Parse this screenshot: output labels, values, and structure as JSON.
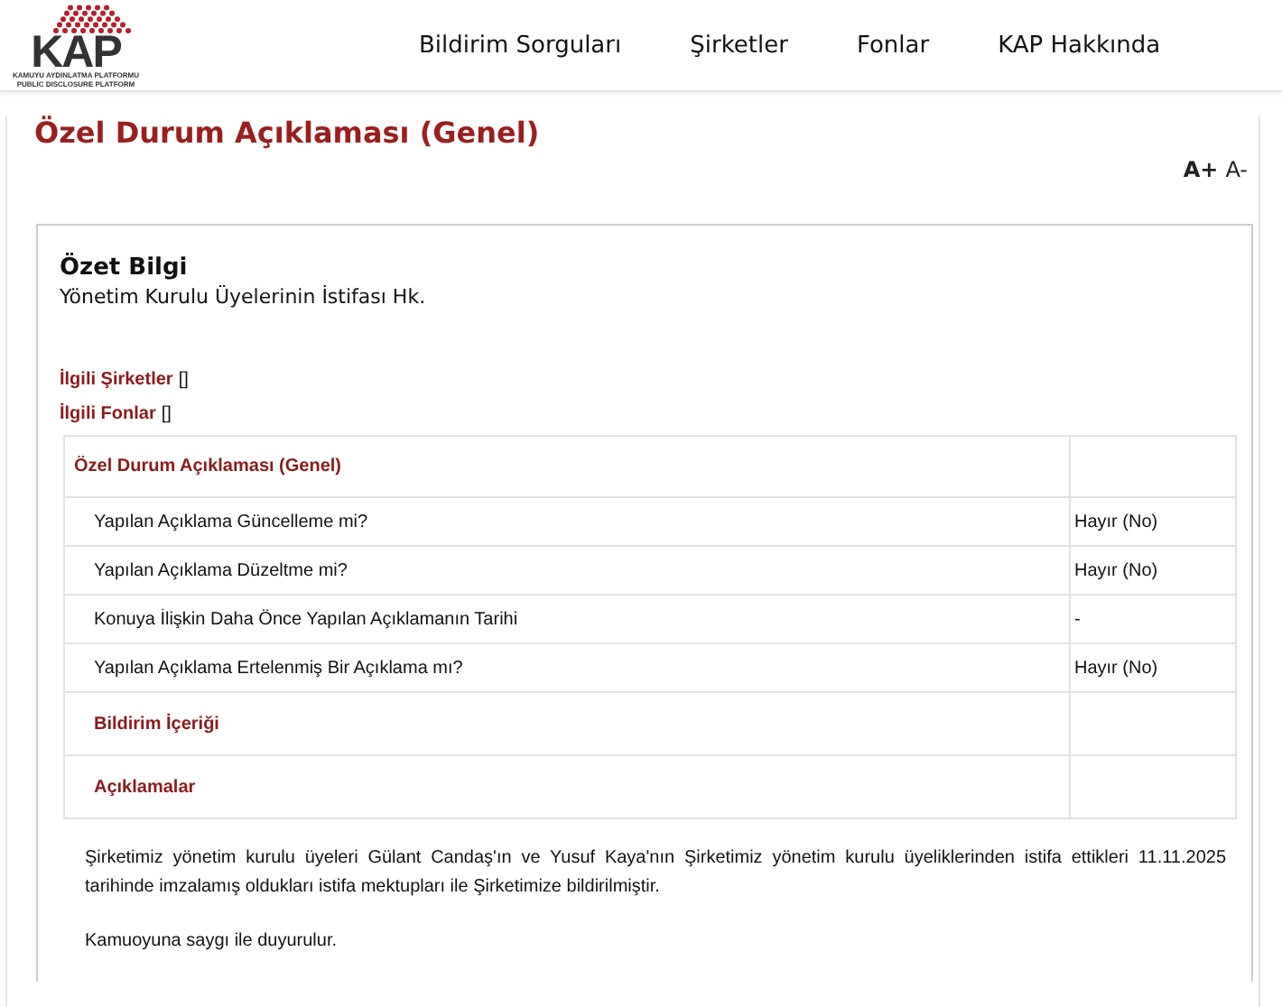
{
  "logo": {
    "mark": "KAP",
    "line_1": "KAMUYU AYDINLATMA PLATFORMU",
    "line_2": "PUBLIC DISCLOSURE PLATFORM"
  },
  "nav": [
    "Bildirim Sorguları",
    "Şirketler",
    "Fonlar",
    "KAP Hakkında"
  ],
  "page_title": "Özel Durum Açıklaması (Genel)",
  "font_controls": [
    "A+",
    "A-"
  ],
  "summary": {
    "heading": "Özet Bilgi",
    "text": "Yönetim Kurulu Üyelerinin İstifası Hk."
  },
  "related": [
    {
      "label": "İlgili Şirketler",
      "value": "[]"
    },
    {
      "label": "İlgili Fonlar",
      "value": "[]"
    }
  ],
  "table": {
    "title": "Özel Durum Açıklaması (Genel)",
    "rows": [
      {
        "kind": "question",
        "label": "Yapılan Açıklama Güncelleme mi?",
        "value": "Hayır (No)"
      },
      {
        "kind": "question",
        "label": "Yapılan Açıklama Düzeltme mi?",
        "value": "Hayır (No)"
      },
      {
        "kind": "question",
        "label": "Konuya İlişkin Daha Önce Yapılan Açıklamanın Tarihi",
        "value": "-"
      },
      {
        "kind": "question",
        "label": "Yapılan Açıklama Ertelenmiş Bir Açıklama mı?",
        "value": "Hayır (No)"
      },
      {
        "kind": "section",
        "label": "Bildirim İçeriği"
      },
      {
        "kind": "section",
        "label": "Açıklamalar"
      }
    ]
  },
  "body": [
    "Şirketimiz yönetim kurulu üyeleri Gülant Candaş'ın ve Yusuf Kaya'nın Şirketimiz yönetim kurulu üyeliklerinden istifa ettikleri 11.11.2025 tarihinde imzalamış oldukları istifa mektupları ile Şirketimize bildirilmiştir.",
    "Kamuoyuna saygı ile duyurulur."
  ]
}
